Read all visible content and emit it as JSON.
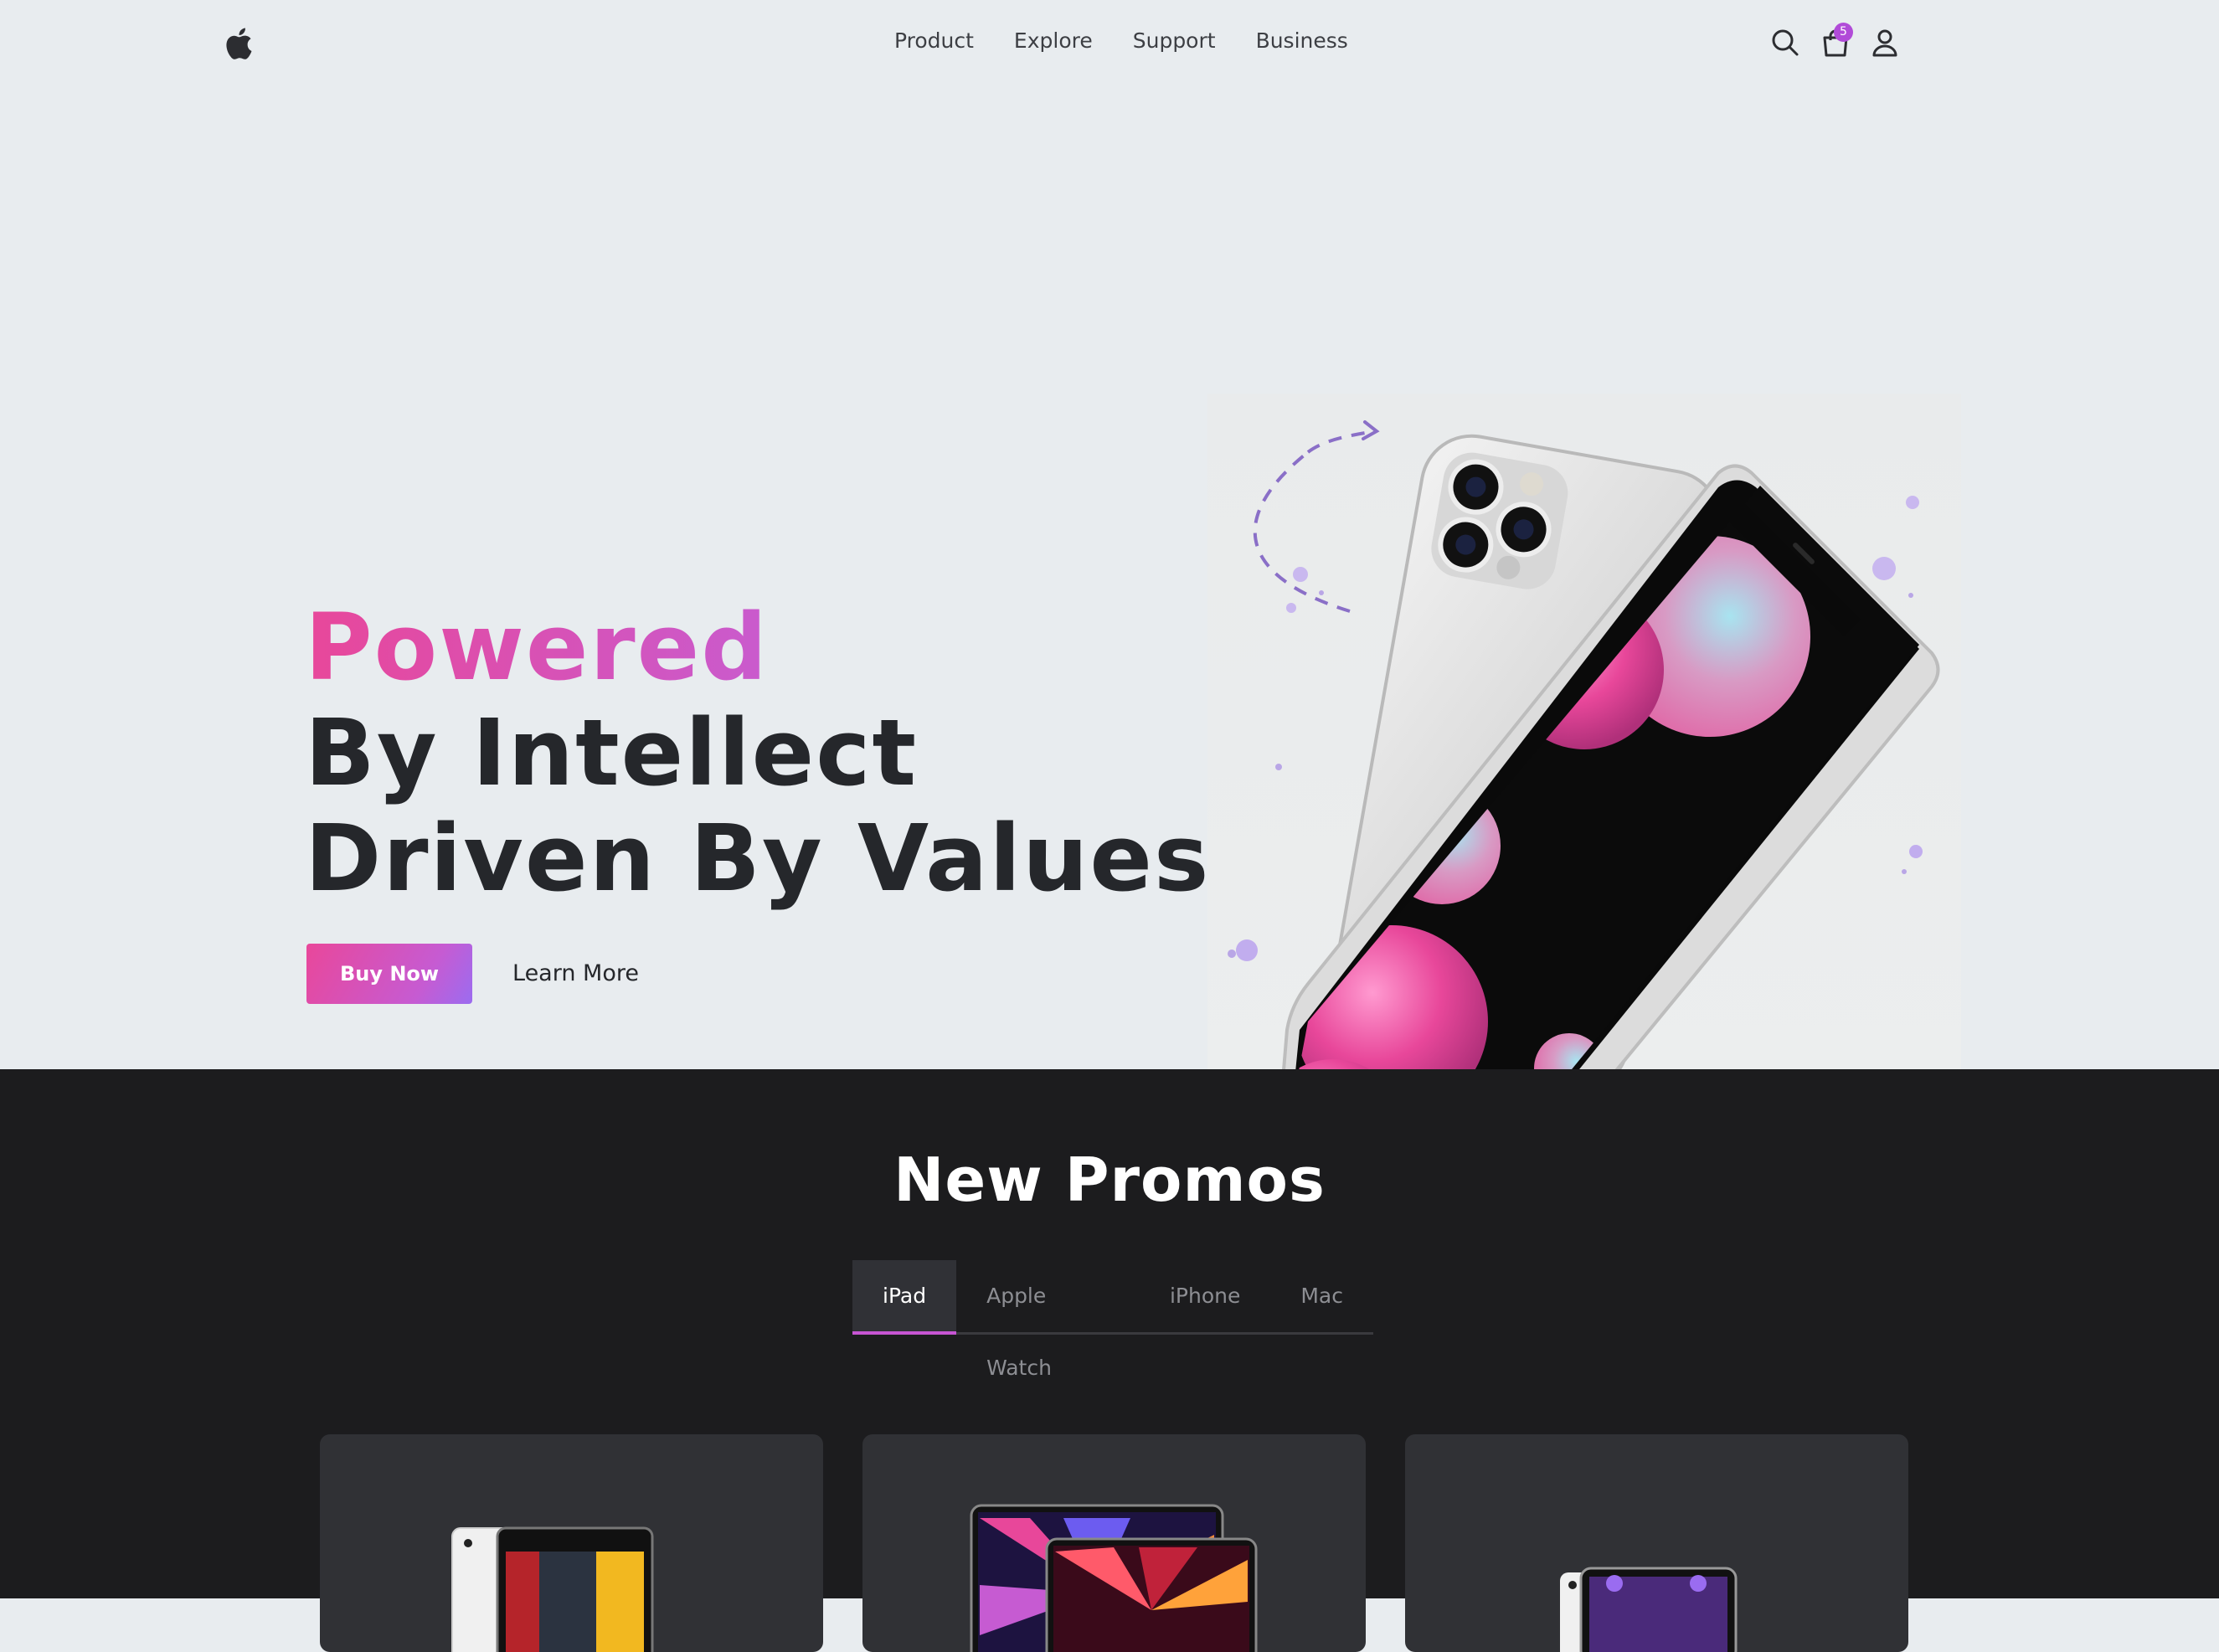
{
  "header": {
    "nav": [
      "Product",
      "Explore",
      "Support",
      "Business"
    ],
    "cart_count": "5",
    "icons": [
      "apple-logo",
      "search-icon",
      "shopping-bag-icon",
      "user-icon"
    ]
  },
  "hero": {
    "line1": "Powered",
    "line2": "By Intellect",
    "line3": "Driven By Values",
    "buy_label": "Buy Now",
    "learn_label": "Learn More"
  },
  "promos": {
    "title": "New Promos",
    "tabs": [
      "iPad",
      "Apple Watch",
      "iPhone",
      "Mac"
    ],
    "active_tab": "iPad"
  },
  "colors": {
    "page_bg": "#e8ecef",
    "accent_pink": "#e8479a",
    "accent_purple": "#c65bd2",
    "dark_section": "#1c1c1e",
    "card_bg": "#303135",
    "headline_dark": "#25272b"
  }
}
